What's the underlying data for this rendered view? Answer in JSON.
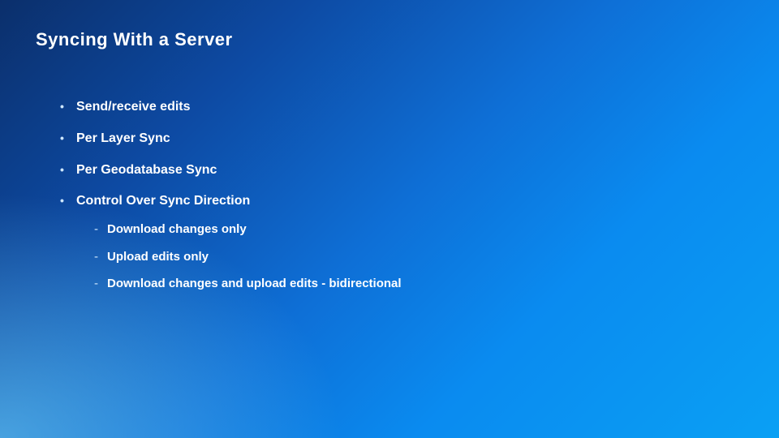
{
  "title": "Syncing With a Server",
  "bullets": [
    {
      "text": "Send/receive edits"
    },
    {
      "text": "Per Layer Sync"
    },
    {
      "text": "Per Geodatabase Sync"
    },
    {
      "text": "Control Over Sync Direction",
      "sub": [
        "Download changes only",
        "Upload edits only",
        "Download changes and upload edits - bidirectional"
      ]
    }
  ]
}
